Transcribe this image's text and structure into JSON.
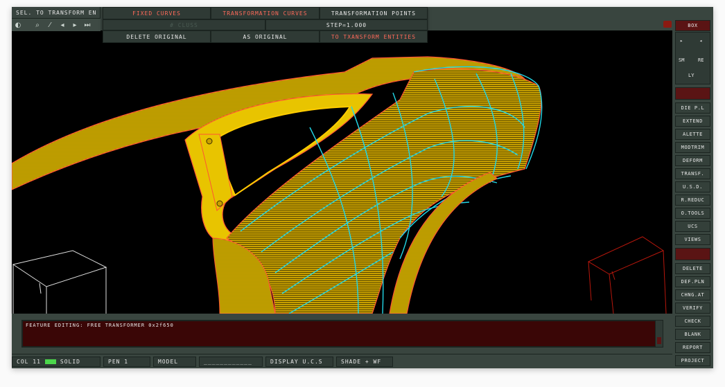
{
  "top_left": {
    "label": "SEL. TO TRANSFORM EN"
  },
  "menu": {
    "row1": [
      "FIXED CURVES",
      "TRANSFORMATION CURVES",
      "TRANSFORMATION POINTS"
    ],
    "row2_left": "# CLUSS",
    "row2_right": "STEP=1.000",
    "row3": [
      "DELETE ORIGINAL",
      "AS ORIGINAL",
      "TO TXANSFORM ENTITIES"
    ]
  },
  "toolbar": {
    "icons": [
      "view-icon",
      "zoom-icon",
      "pen-icon",
      "arrow-left-icon",
      "arrow-right-icon",
      "end-icon"
    ]
  },
  "right_panel": {
    "top": "BOX",
    "nav": {
      "tl": "▸",
      "tr": "◂",
      "sm": "SM",
      "re": "RE",
      "ly": "LY"
    },
    "group1": [
      "DIE P.L",
      "EXTEND",
      "ALETTE",
      "MODTRIM",
      "DEFORM",
      "TRANSF.",
      "U.S.D.",
      "R.REDUC",
      "O.TOOLS",
      "UCS",
      "VIEWS"
    ],
    "group2": [
      "DELETE",
      "DEF.PLN",
      "CHNG.AT",
      "VERIFY",
      "CHECK",
      "BLANK",
      "REPORT",
      "PROJECT"
    ]
  },
  "console": {
    "message": "FEATURE EDITING: FREE TRANSFORMER 0x2f650"
  },
  "status": {
    "col_label": "COL 11",
    "col_color": "#4bd64b",
    "solid": "SOLID",
    "pen": "PEN 1",
    "model": "MODEL",
    "blank": "____________",
    "display": "DISPLAY U.C.S",
    "shade": "SHADE + WF"
  },
  "colors": {
    "body": "#f0c800",
    "mesh": "#22d8e8",
    "outline": "#ff5533",
    "wire": "#e0e0e0",
    "wire_red": "#b8170c"
  }
}
